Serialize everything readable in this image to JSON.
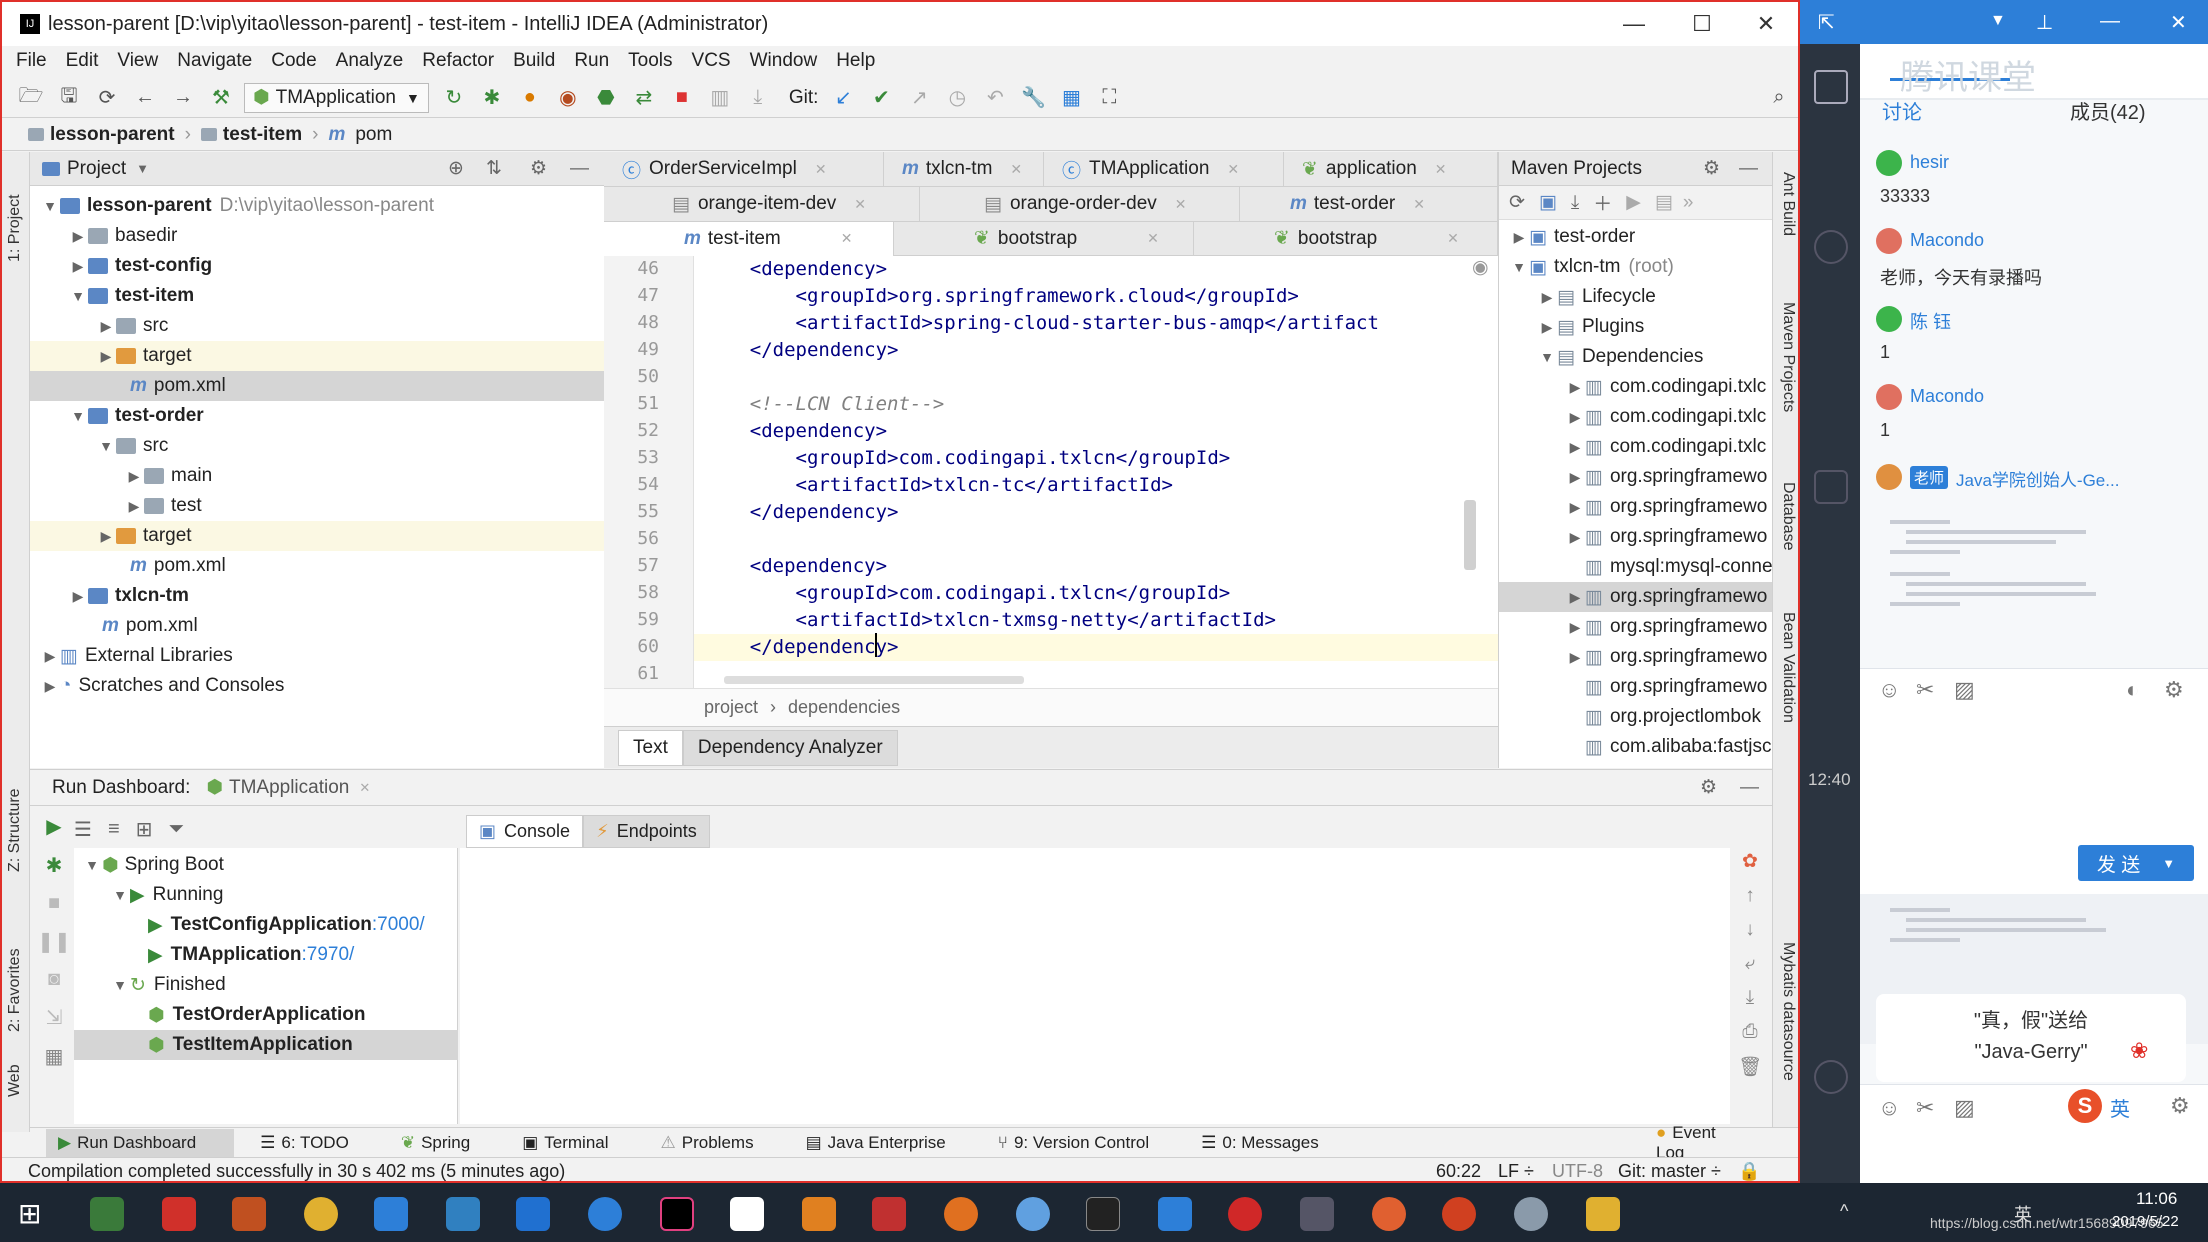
{
  "window": {
    "title": "lesson-parent [D:\\vip\\yitao\\lesson-parent] - test-item - IntelliJ IDEA (Administrator)",
    "min": "—",
    "max": "☐",
    "close": "✕"
  },
  "menu": [
    "File",
    "Edit",
    "View",
    "Navigate",
    "Code",
    "Analyze",
    "Refactor",
    "Build",
    "Run",
    "Tools",
    "VCS",
    "Window",
    "Help"
  ],
  "toolbar": {
    "run_config": "TMApplication",
    "git_label": "Git:"
  },
  "breadcrumb": [
    "lesson-parent",
    "test-item",
    "pom"
  ],
  "project": {
    "header": "Project",
    "rows": [
      {
        "label": "lesson-parent",
        "extra": "D:\\vip\\yitao\\lesson-parent"
      },
      {
        "label": "basedir"
      },
      {
        "label": "test-config"
      },
      {
        "label": "test-item"
      },
      {
        "label": "src"
      },
      {
        "label": "target"
      },
      {
        "label": "pom.xml"
      },
      {
        "label": "test-order"
      },
      {
        "label": "src"
      },
      {
        "label": "main"
      },
      {
        "label": "test"
      },
      {
        "label": "target"
      },
      {
        "label": "pom.xml"
      },
      {
        "label": "txlcn-tm"
      },
      {
        "label": "pom.xml"
      },
      {
        "label": "External Libraries"
      },
      {
        "label": "Scratches and Consoles"
      }
    ]
  },
  "editor_tabs": {
    "row1": [
      "OrderServiceImpl",
      "txlcn-tm",
      "TMApplication",
      "application"
    ],
    "row2": [
      "orange-item-dev",
      "orange-order-dev",
      "test-order"
    ],
    "row3": [
      "test-item",
      "bootstrap",
      "bootstrap"
    ]
  },
  "editor": {
    "lines": [
      {
        "n": "46",
        "text": "    <dependency>"
      },
      {
        "n": "47",
        "text": "        <groupId>org.springframework.cloud</groupId>"
      },
      {
        "n": "48",
        "text": "        <artifactId>spring-cloud-starter-bus-amqp</artifact"
      },
      {
        "n": "49",
        "text": "    </dependency>"
      },
      {
        "n": "50",
        "text": ""
      },
      {
        "n": "51",
        "text": "    <!--LCN Client-->"
      },
      {
        "n": "52",
        "text": "    <dependency>"
      },
      {
        "n": "53",
        "text": "        <groupId>com.codingapi.txlcn</groupId>"
      },
      {
        "n": "54",
        "text": "        <artifactId>txlcn-tc</artifactId>"
      },
      {
        "n": "55",
        "text": "    </dependency>"
      },
      {
        "n": "56",
        "text": ""
      },
      {
        "n": "57",
        "text": "    <dependency>"
      },
      {
        "n": "58",
        "text": "        <groupId>com.codingapi.txlcn</groupId>"
      },
      {
        "n": "59",
        "text": "        <artifactId>txlcn-txmsg-netty</artifactId>"
      },
      {
        "n": "60",
        "text": "    </dependency>"
      },
      {
        "n": "61",
        "text": ""
      }
    ],
    "crumbs": [
      "project",
      "dependencies"
    ],
    "bottom_tabs": [
      "Text",
      "Dependency Analyzer"
    ]
  },
  "maven": {
    "header": "Maven Projects",
    "rows": [
      {
        "label": "test-order"
      },
      {
        "label": "txlcn-tm",
        "extra": "(root)"
      },
      {
        "label": "Lifecycle"
      },
      {
        "label": "Plugins"
      },
      {
        "label": "Dependencies"
      },
      {
        "label": "com.codingapi.txlc"
      },
      {
        "label": "com.codingapi.txlc"
      },
      {
        "label": "com.codingapi.txlc"
      },
      {
        "label": "org.springframewo"
      },
      {
        "label": "org.springframewo"
      },
      {
        "label": "org.springframewo"
      },
      {
        "label": "mysql:mysql-conne"
      },
      {
        "label": "org.springframewo"
      },
      {
        "label": "org.springframewo"
      },
      {
        "label": "org.springframewo"
      },
      {
        "label": "org.springframewo"
      },
      {
        "label": "org.projectlombok"
      },
      {
        "label": "com.alibaba:fastjsc"
      }
    ]
  },
  "run_dashboard": {
    "title": "Run Dashboard:",
    "config": "TMApplication",
    "tabs": [
      "Console",
      "Endpoints"
    ],
    "tree": [
      {
        "label": "Spring Boot"
      },
      {
        "label": "Running"
      },
      {
        "label": "TestConfigApplication",
        "port": ":7000/"
      },
      {
        "label": "TMApplication",
        "port": ":7970/"
      },
      {
        "label": "Finished"
      },
      {
        "label": "TestOrderApplication"
      },
      {
        "label": "TestItemApplication"
      }
    ]
  },
  "bottom_tools": [
    "Run Dashboard",
    "6: TODO",
    "Spring",
    "Terminal",
    "Problems",
    "Java Enterprise",
    "9: Version Control",
    "0: Messages",
    "Event Log"
  ],
  "left_labels": [
    "1: Project",
    "Z: Structure",
    "2: Favorites",
    "Web"
  ],
  "right_labels": [
    "Ant Build",
    "Maven Projects",
    "Database",
    "Bean Validation",
    "Mybatis datasource"
  ],
  "status": {
    "message": "Compilation completed successfully in 30 s 402 ms (5 minutes ago)",
    "position": "60:22",
    "line_sep": "LF ÷",
    "encoding": "UTF-8",
    "git": "Git: master ÷"
  },
  "chat": {
    "watermark": "腾讯课堂",
    "tabs": [
      "讨论",
      "成员(42)"
    ],
    "messages": [
      {
        "name": "hesir",
        "text": "33333"
      },
      {
        "name": "Macondo",
        "text": "老师，今天有录播吗"
      },
      {
        "name": "陈 钰",
        "text": "1"
      },
      {
        "name": "Macondo",
        "text": "1"
      },
      {
        "name": "Java学院创始人-Ge...",
        "badge": "老师"
      }
    ],
    "send_label": "发 送",
    "side_time": "12:40",
    "gift_line1": "\"真，假\"送给",
    "gift_line2": "\"Java-Gerry\"",
    "ime": "英"
  },
  "taskbar": {
    "time": "11:06",
    "date": "2019/5/22",
    "url": "https://blog.csdn.net/wtr15689097965",
    "lang": "英"
  },
  "colors": {
    "accent": "#2d7fd8",
    "highlight_border": "#e0302a",
    "taskbar": "#1c2632"
  }
}
